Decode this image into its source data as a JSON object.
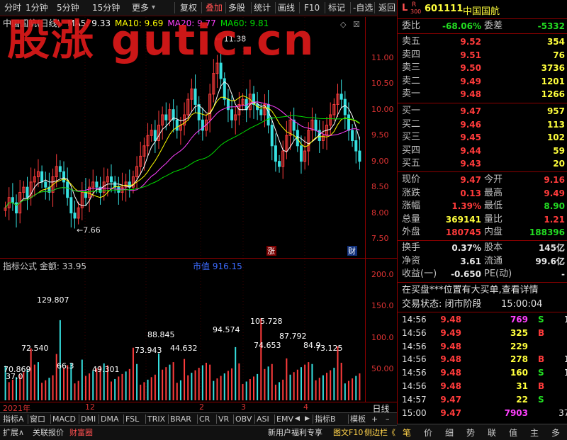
{
  "toolbar": {
    "items": [
      "分时",
      "1分钟",
      "5分钟",
      "15分钟",
      "更多",
      "复权",
      "叠加",
      "多股",
      "统计",
      "画线",
      "F10",
      "标记",
      "-自选",
      "返回"
    ],
    "selected": "叠加"
  },
  "watermark": "股涨 gutic.cn",
  "chart": {
    "title": "中国国航(日线)",
    "ma": [
      {
        "label": "MA5: 9.33",
        "color": "#ffffff"
      },
      {
        "label": "MA10: 9.69",
        "color": "#ffff00"
      },
      {
        "label": "MA20: 9.77",
        "color": "#ff40ff"
      },
      {
        "label": "MA60: 9.81",
        "color": "#00dd00"
      }
    ],
    "price_ticks": [
      "11.00",
      "10.50",
      "10.00",
      "9.50",
      "9.00",
      "8.50",
      "8.00",
      "7.50"
    ],
    "high_label": "11.38",
    "low_label": "7.66",
    "badge_zhang": "涨",
    "badge_cai": "财"
  },
  "chart_data": {
    "type": "candlestick",
    "ylim": [
      7.2,
      11.6
    ],
    "close": [
      8.1,
      8.3,
      8.2,
      8.0,
      8.4,
      8.5,
      8.3,
      8.6,
      8.7,
      8.8,
      8.6,
      8.5,
      8.4,
      8.7,
      8.9,
      8.8,
      8.6,
      8.3,
      8.0,
      7.9,
      8.1,
      8.4,
      8.3,
      8.5,
      8.6,
      8.5,
      8.4,
      8.6,
      8.7,
      8.6,
      8.5,
      8.4,
      8.5,
      8.6,
      8.5,
      8.7,
      8.9,
      9.1,
      9.3,
      9.5,
      9.6,
      9.4,
      9.7,
      9.9,
      9.8,
      10.0,
      9.8,
      9.6,
      9.7,
      9.9,
      10.2,
      10.4,
      10.1,
      9.8,
      9.6,
      9.8,
      10.3,
      10.7,
      10.9,
      10.6,
      10.2,
      10.0,
      9.8,
      9.9,
      10.1,
      10.2,
      10.0,
      10.3,
      10.1,
      10.0,
      9.9,
      10.1,
      9.7,
      9.3,
      9.0,
      8.9,
      9.2,
      9.5,
      9.8,
      9.6,
      9.3,
      9.0,
      9.2,
      9.6,
      9.8,
      9.6,
      9.4,
      9.5,
      9.7,
      9.9,
      10.1,
      10.3,
      10.2,
      9.9,
      9.6,
      9.4,
      9.2,
      9.0
    ]
  },
  "indicator": {
    "title": "指标公式 金额: 33.95",
    "market_value": "市值 916.15",
    "ticks": [
      "200.0",
      "150.0",
      "100.0",
      "50.00"
    ],
    "labels": [
      "129.807",
      "105.728",
      "94.574",
      "88.845",
      "87.792",
      "84.9",
      "74.653",
      "73.943",
      "73.125",
      "72.540",
      "70.869",
      "66.3",
      "49.301",
      "44.632",
      "37.0"
    ]
  },
  "date_axis": {
    "labels": [
      "2021年",
      "12",
      "2",
      "3",
      "4"
    ],
    "period": "日线"
  },
  "tabs": [
    "指标A",
    "窗口",
    "MACD",
    "DMI",
    "DMA",
    "FSL",
    "TRIX",
    "BRAR",
    "CR",
    "VR",
    "OBV",
    "ASI",
    "EMV",
    "指标B",
    "模板"
  ],
  "bottom": {
    "left": [
      "扩展∧",
      "关联报价",
      "财富圈"
    ],
    "news": "新用户福利专享",
    "right": [
      "图文F10",
      "侧边栏《"
    ]
  },
  "quote": {
    "code": "601111",
    "name": "中国国航",
    "wei_bi_label": "委比",
    "wei_bi": "-68.06%",
    "wei_cha_label": "委差",
    "wei_cha": "-5332",
    "sells": [
      {
        "label": "卖五",
        "price": "9.52",
        "vol": "354"
      },
      {
        "label": "卖四",
        "price": "9.51",
        "vol": "76"
      },
      {
        "label": "卖三",
        "price": "9.50",
        "vol": "3736"
      },
      {
        "label": "卖二",
        "price": "9.49",
        "vol": "1201"
      },
      {
        "label": "卖一",
        "price": "9.48",
        "vol": "1266"
      }
    ],
    "buys": [
      {
        "label": "买一",
        "price": "9.47",
        "vol": "957"
      },
      {
        "label": "买二",
        "price": "9.46",
        "vol": "113"
      },
      {
        "label": "买三",
        "price": "9.45",
        "vol": "102"
      },
      {
        "label": "买四",
        "price": "9.44",
        "vol": "59"
      },
      {
        "label": "买五",
        "price": "9.43",
        "vol": "20"
      }
    ],
    "stats": [
      {
        "l1": "现价",
        "v1": "9.47",
        "l2": "今开",
        "v2": "9.16"
      },
      {
        "l1": "涨跌",
        "v1": "0.13",
        "l2": "最高",
        "v2": "9.49"
      },
      {
        "l1": "涨幅",
        "v1": "1.39%",
        "l2": "最低",
        "v2": "8.90"
      },
      {
        "l1": "总量",
        "v1": "369141",
        "l2": "量比",
        "v2": "1.21"
      },
      {
        "l1": "外盘",
        "v1": "180745",
        "l2": "内盘",
        "v2": "188396"
      }
    ],
    "stats2": [
      {
        "l1": "换手",
        "v1": "0.37%",
        "l2": "股本",
        "v2": "145亿"
      },
      {
        "l1": "净资",
        "v1": "3.61",
        "l2": "流通",
        "v2": "99.6亿"
      },
      {
        "l1": "收益(一)",
        "v1": "-0.650",
        "l2": "PE(动)",
        "v2": "-"
      }
    ],
    "notice": "在买盘***位置有大买单,查看详情",
    "trade_state": "交易状态: 闭市阶段",
    "trade_time": "15:00:04",
    "ticks": [
      {
        "t": "14:56",
        "p": "9.48",
        "v": "769",
        "s": "S"
      },
      {
        "t": "14:56",
        "p": "9.49",
        "v": "325",
        "s": "B"
      },
      {
        "t": "14:56",
        "p": "9.48",
        "v": "229",
        "s": ""
      },
      {
        "t": "14:56",
        "p": "9.48",
        "v": "278",
        "s": "B"
      },
      {
        "t": "14:56",
        "p": "9.48",
        "v": "160",
        "s": "S"
      },
      {
        "t": "14:56",
        "p": "9.48",
        "v": "31",
        "s": "B"
      },
      {
        "t": "14:57",
        "p": "9.47",
        "v": "22",
        "s": "S"
      },
      {
        "t": "15:00",
        "p": "9.47",
        "v": "7903",
        "s": ""
      }
    ],
    "tick_extra": [
      "10",
      "6",
      "4",
      "18",
      "13",
      "6",
      "4",
      "370"
    ],
    "bottom_tabs": [
      "笔",
      "价",
      "细",
      "势",
      "联",
      "值",
      "主",
      "多"
    ]
  }
}
